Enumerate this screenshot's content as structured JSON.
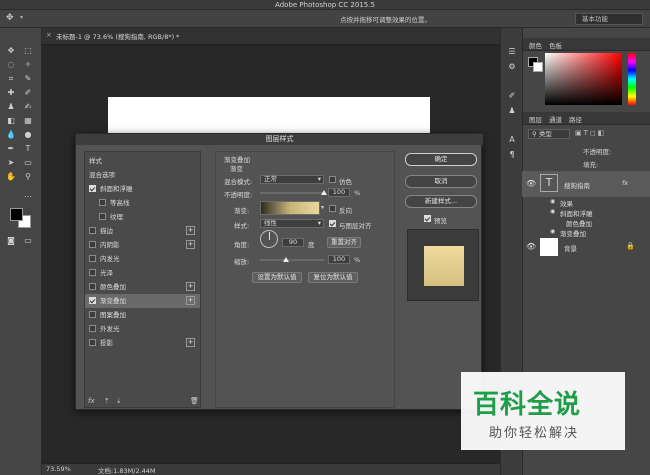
{
  "window": {
    "title": "Adobe Photoshop CC 2015.5"
  },
  "options_bar": {
    "hint": "点按并拖移可调整效果的位置。",
    "workspace": "基本功能"
  },
  "document": {
    "tab_title": "未标题-1 @ 73.6% (搜狗指南, RGB/8*) *"
  },
  "status": {
    "zoom": "73.59%",
    "doc_info": "文档:1.83M/2.44M"
  },
  "panels": {
    "color_tabs": [
      "颜色",
      "色板"
    ],
    "layer_tabs": [
      "图层",
      "通道",
      "路径"
    ],
    "filter_kind": "类型",
    "opacity_label": "不透明度:",
    "fill_label": "填充:",
    "fx_label": "fx",
    "layers": [
      {
        "name": "搜狗指南",
        "type": "text"
      },
      {
        "name": "效果",
        "type": "effects-group"
      },
      {
        "name": "斜面和浮雕",
        "type": "effect"
      },
      {
        "name": "颜色叠加",
        "type": "effect"
      },
      {
        "name": "渐变叠加",
        "type": "effect"
      },
      {
        "name": "背景",
        "type": "background"
      }
    ]
  },
  "dialog": {
    "title": "图层样式",
    "styles_header": "样式",
    "blend_options": "混合选项",
    "effects": [
      {
        "label": "斜面和浮雕",
        "checked": true,
        "plus": false,
        "indent": false
      },
      {
        "label": "等高线",
        "checked": false,
        "plus": false,
        "indent": true
      },
      {
        "label": "纹理",
        "checked": false,
        "plus": false,
        "indent": true
      },
      {
        "label": "描边",
        "checked": false,
        "plus": true,
        "indent": false
      },
      {
        "label": "内阴影",
        "checked": false,
        "plus": true,
        "indent": false
      },
      {
        "label": "内发光",
        "checked": false,
        "plus": false,
        "indent": false
      },
      {
        "label": "光泽",
        "checked": false,
        "plus": false,
        "indent": false
      },
      {
        "label": "颜色叠加",
        "checked": false,
        "plus": true,
        "indent": false
      },
      {
        "label": "渐变叠加",
        "checked": true,
        "plus": true,
        "indent": false,
        "selected": true
      },
      {
        "label": "图案叠加",
        "checked": false,
        "plus": false,
        "indent": false
      },
      {
        "label": "外发光",
        "checked": false,
        "plus": false,
        "indent": false
      },
      {
        "label": "投影",
        "checked": false,
        "plus": true,
        "indent": false
      }
    ],
    "fx": "fx",
    "section_title": "渐变叠加",
    "section_subtitle": "渐变",
    "blend_mode_label": "混合模式:",
    "blend_mode": "正常",
    "dither_label": "仿色",
    "opacity_label": "不透明度:",
    "opacity_value": "100",
    "opacity_fraction": 1.0,
    "percent": "%",
    "gradient_label": "渐变:",
    "reverse_label": "反向",
    "style_label": "样式:",
    "style_value": "线性",
    "align_label": "与图层对齐",
    "angle_label": "角度:",
    "angle_value": "90",
    "degree_label": "度",
    "reset_align": "重置对齐",
    "scale_label": "缩放:",
    "scale_value": "100",
    "scale_fraction": 0.4,
    "set_default": "设置为默认值",
    "reset_default": "复位为默认值",
    "ok": "确定",
    "cancel": "取消",
    "new_style": "新建样式...",
    "preview_label": "预览"
  },
  "watermark": {
    "title": "百科全说",
    "subtitle": "助你轻松解决"
  },
  "colors": {
    "foreground": "#000000",
    "background": "#ffffff",
    "preview_fill": "#e3cf90",
    "accent_green": "#1e9e49"
  }
}
